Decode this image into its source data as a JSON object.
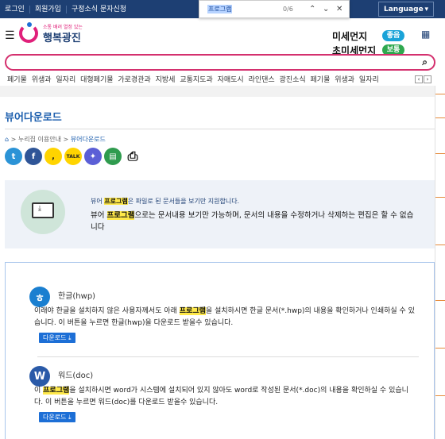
{
  "topbar": {
    "login": "로그인",
    "join": "회원가입",
    "sms": "구정소식 문자신청",
    "language": "Language"
  },
  "find": {
    "query": "프로그램",
    "count": "0/6"
  },
  "header": {
    "logo_small": "소통 배려 열정 있는",
    "logo_text": "행복광진",
    "dust1": "미세먼지",
    "dust1_status": "좋음",
    "dust2": "초미세먼지",
    "dust2_status": "보통",
    "good_color": "#1aa3d8",
    "normal_color": "#2fa84f"
  },
  "search": {
    "placeholder": ""
  },
  "menu": {
    "text": "페기물 위생과 일자리 대형페기물 가로경관과 지방세 교통지도과 자매도시 라인댄스 광진소식 페기물 위생과 일자리"
  },
  "page": {
    "title": "뷰어다운로드",
    "crumb1": "누리집 이용안내",
    "crumb2": "뷰어다운로드"
  },
  "info": {
    "small_pre": "뷰어 ",
    "small_hl": "프로그램",
    "small_post": "은 파일로 된 문서들을 보기만 지원합니다.",
    "big_pre": "뷰어 ",
    "big_hl": "프로그램",
    "big_post": "으로는 문서내용 보기만 가능하며, 문서의 내용을 수정하거나 삭제하는 편집은 할 수 없습니다"
  },
  "hwp": {
    "icon": "ㅎ",
    "name": "한글(hwp)",
    "pre": "이래야 한글을 설치하지 않은 사용자께서도 아래 ",
    "hl": "프로그램",
    "post": "을 설치하시면 한글 문서(*.hwp)의 내용을 확인하거나 인쇄하실 수 있습니다. 이 버튼을 누르면 한글(hwp)을 다운로드 받을수 있습니다.",
    "download": "다운로드"
  },
  "doc": {
    "icon": "W",
    "name": "워드(doc)",
    "pre": "이 ",
    "hl": "프로그램",
    "post": "을 설치하시면 word가 시스템에 설치되어 있지 않아도 word로 작성된 문서(*.doc)의 내용을 확인하실 수 있습니다. 이 버튼을 누르면 워드(doc)를 다운로드 받을수 있습니다.",
    "download": "다운로드"
  }
}
